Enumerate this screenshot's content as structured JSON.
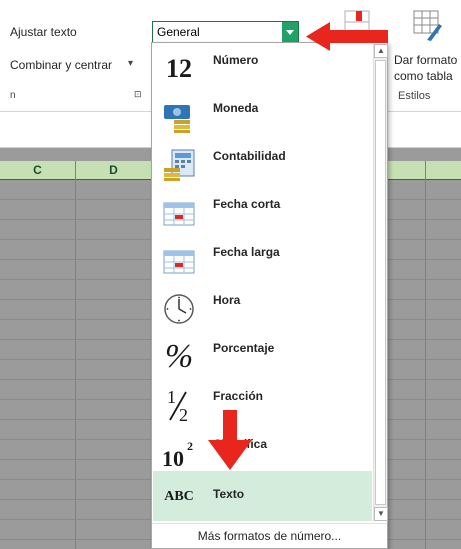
{
  "ribbon": {
    "wrap_text_label": "Ajustar texto",
    "merge_center_label": "Combinar y centrar",
    "merge_dropdown_glyph": "▾",
    "alignment_group_fragment": "n",
    "dialog_launcher_glyph": "⊡",
    "number_format_value": "General",
    "format_as_table_line1": "Dar formato",
    "format_as_table_line2": "como tabla",
    "styles_group_label": "Estilos"
  },
  "columns": [
    "C",
    "D"
  ],
  "dropdown": {
    "items": [
      {
        "label": "Número",
        "icon": "number-icon",
        "glyph": "12"
      },
      {
        "label": "Moneda",
        "icon": "currency-icon"
      },
      {
        "label": "Contabilidad",
        "icon": "accounting-icon"
      },
      {
        "label": "Fecha corta",
        "icon": "short-date-icon"
      },
      {
        "label": "Fecha larga",
        "icon": "long-date-icon"
      },
      {
        "label": "Hora",
        "icon": "clock-icon"
      },
      {
        "label": "Porcentaje",
        "icon": "percent-icon",
        "glyph": "%"
      },
      {
        "label": "Fracción",
        "icon": "fraction-icon",
        "glyph_num": "1",
        "glyph_den": "2"
      },
      {
        "label": "Científica",
        "icon": "scientific-icon",
        "glyph_base": "10",
        "glyph_exp": "2"
      },
      {
        "label": "Texto",
        "icon": "text-format-icon",
        "glyph": "ABC",
        "selected": true
      }
    ],
    "more_formats_label": "Más formatos de número..."
  },
  "colors": {
    "accent_green": "#217346",
    "selected_bg": "#d3ecdc",
    "annotation_red": "#e8261d"
  }
}
